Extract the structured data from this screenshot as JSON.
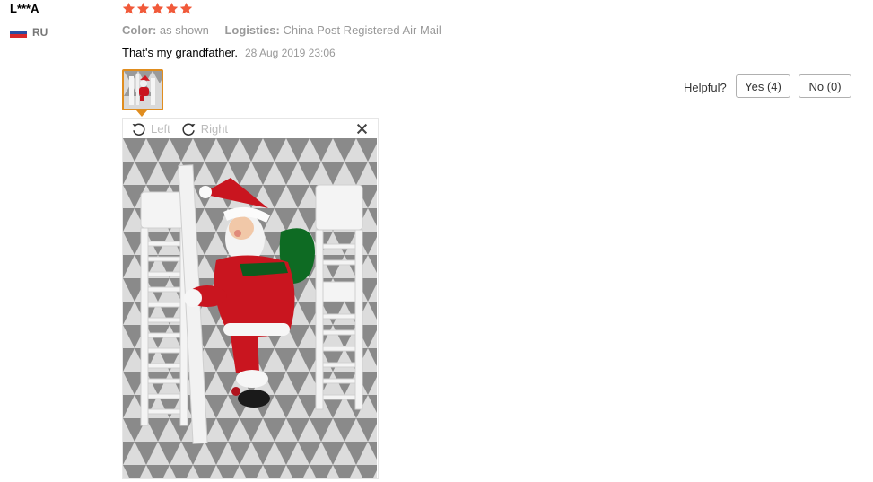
{
  "review": {
    "user_name": "L***A",
    "country_code": "RU",
    "rating": 5,
    "color_label": "Color:",
    "color_value": "as shown",
    "logistics_label": "Logistics:",
    "logistics_value": "China Post Registered Air Mail",
    "feedback_text": "That's my grandfather.",
    "date": "28 Aug 2019 23:06"
  },
  "helpful": {
    "label": "Helpful?",
    "yes_label": "Yes (4)",
    "no_label": "No (0)"
  },
  "viewer": {
    "rotate_left_label": "Left",
    "rotate_right_label": "Right",
    "close_icon": "close-icon"
  },
  "colors": {
    "star": "#f15a3a",
    "thumb_border": "#e08d1f",
    "muted_text": "#999999"
  }
}
